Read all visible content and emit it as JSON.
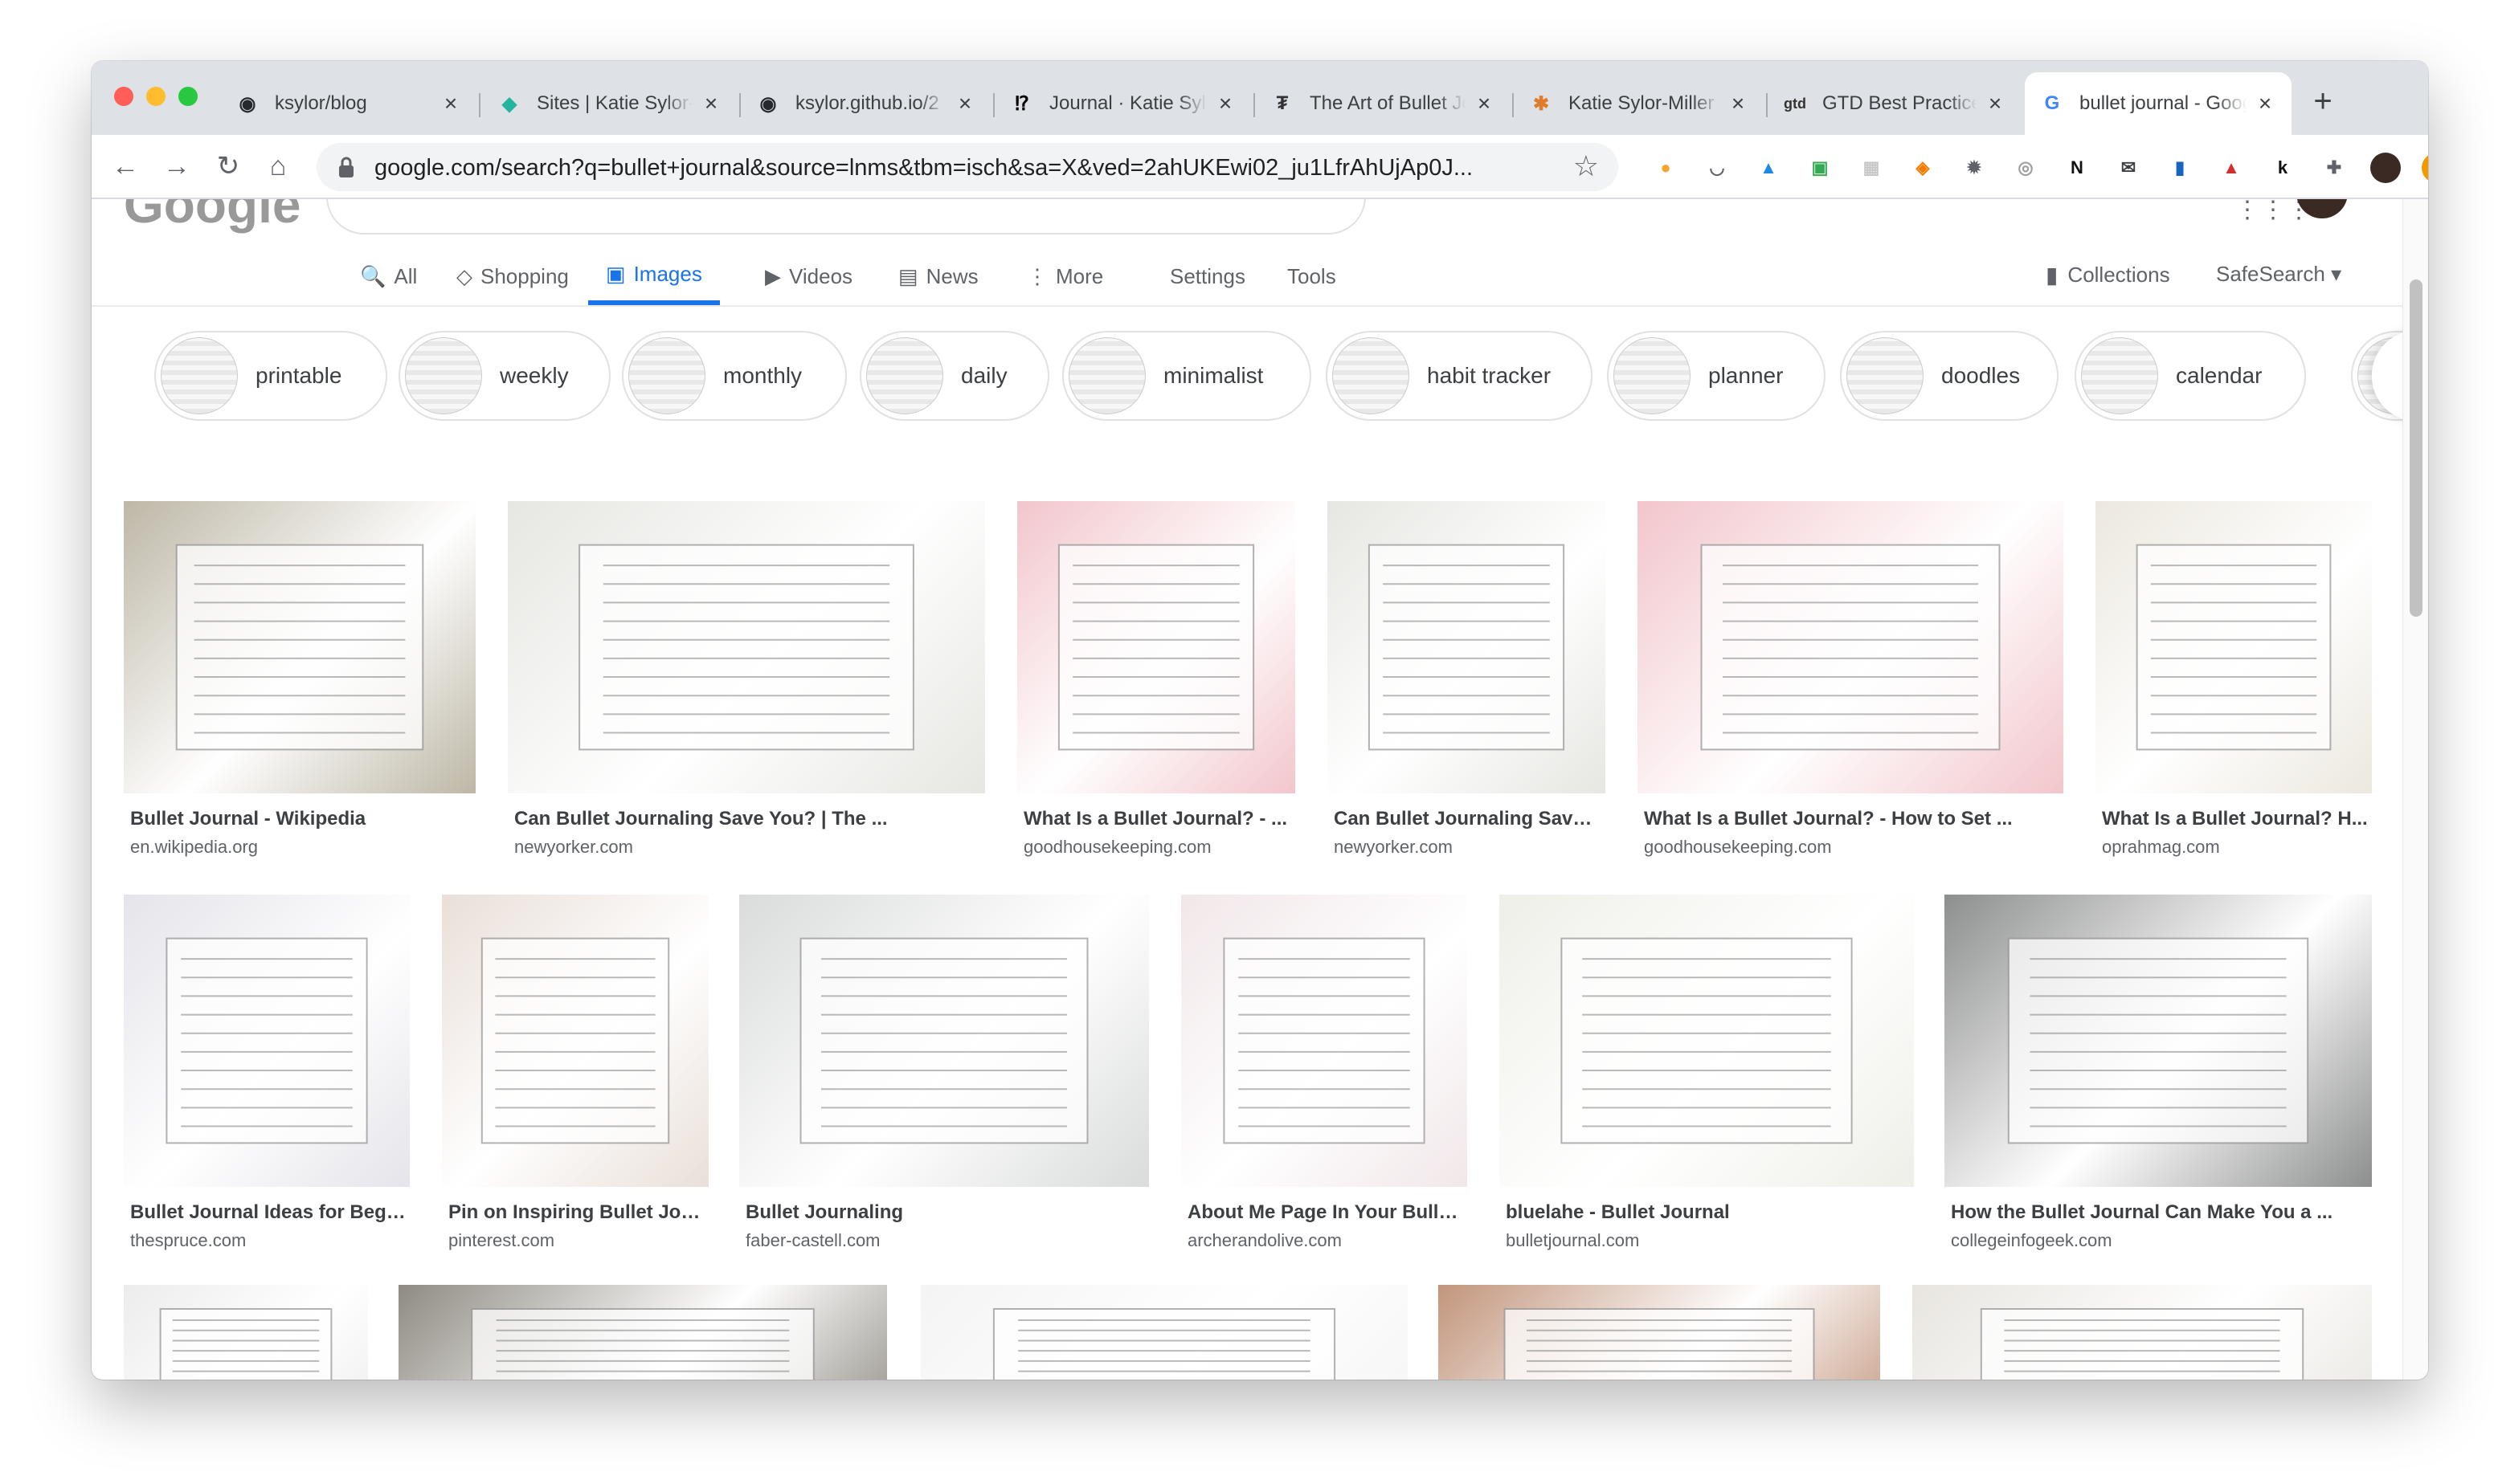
{
  "browser": {
    "tabs": [
      {
        "title": "ksylor/blog",
        "icon": "github-icon",
        "fav": "◉",
        "color": "#24292e"
      },
      {
        "title": "Sites | Katie Sylor-Miller",
        "icon": "netlify-icon",
        "fav": "◆",
        "color": "#25b59f"
      },
      {
        "title": "ksylor.github.io/2",
        "icon": "github-icon",
        "fav": "◉",
        "color": "#24292e"
      },
      {
        "title": "Journal · Katie Sylor-Miller",
        "icon": "journal-icon",
        "fav": "⁉",
        "color": "#000000"
      },
      {
        "title": "The Art of Bullet Journaling",
        "icon": "site-icon",
        "fav": "₮",
        "color": "#333333"
      },
      {
        "title": "Katie Sylor-Miller",
        "icon": "asterisk-icon",
        "fav": "✱",
        "color": "#e07b2a"
      },
      {
        "title": "GTD Best Practices",
        "icon": "gtd-icon",
        "fav": "gtd",
        "color": "#333333"
      },
      {
        "title": "bullet journal - Google Search",
        "icon": "google-icon",
        "fav": "G",
        "color": "#4285f4",
        "active": true
      }
    ],
    "new_tab": "+",
    "url": "google.com/search?q=bullet+journal&source=lnms&tbm=isch&sa=X&ved=2ahUKEwi02_ju1LfrAhUjAp0J...",
    "extensions": [
      {
        "name": "extension-chrome-icon",
        "glyph": "●",
        "color": "#f4a430"
      },
      {
        "name": "extension-pocket-icon",
        "glyph": "◡",
        "color": "#5f6368"
      },
      {
        "name": "extension-drive-icon",
        "glyph": "▲",
        "color": "#1e88e5"
      },
      {
        "name": "extension-green-icon",
        "glyph": "▣",
        "color": "#34a853"
      },
      {
        "name": "extension-gray-icon",
        "glyph": "▦",
        "color": "#c8c8c8"
      },
      {
        "name": "extension-orange-icon",
        "glyph": "◈",
        "color": "#f57c00"
      },
      {
        "name": "extension-gear-icon",
        "glyph": "✹",
        "color": "#5f6368"
      },
      {
        "name": "extension-circle-icon",
        "glyph": "◎",
        "color": "#9e9e9e"
      },
      {
        "name": "extension-notion-icon",
        "glyph": "N",
        "color": "#111111"
      },
      {
        "name": "extension-mail-icon",
        "glyph": "✉",
        "color": "#3c4043"
      },
      {
        "name": "extension-bars-icon",
        "glyph": "▮",
        "color": "#1565c0"
      },
      {
        "name": "extension-lastpass-icon",
        "glyph": "▲",
        "color": "#d32f2f"
      },
      {
        "name": "extension-k-icon",
        "glyph": "k",
        "color": "#111111"
      },
      {
        "name": "extension-puzzle-icon",
        "glyph": "✚",
        "color": "#5f6368"
      },
      {
        "name": "profile-avatar-icon",
        "glyph": "●",
        "color": "#3b2a24"
      },
      {
        "name": "update-icon",
        "glyph": "↑",
        "color": "#f29900"
      }
    ]
  },
  "google": {
    "nav": [
      {
        "label": "All",
        "icon": "🔍"
      },
      {
        "label": "Shopping",
        "icon": "◇"
      },
      {
        "label": "Images",
        "icon": "▣",
        "active": true
      },
      {
        "label": "Videos",
        "icon": "▶"
      },
      {
        "label": "News",
        "icon": "▤"
      },
      {
        "label": "More",
        "icon": "⋮"
      }
    ],
    "settings": "Settings",
    "tools": "Tools",
    "collections": "Collections",
    "safesearch": "SafeSearch ▾",
    "chips": [
      "printable",
      "weekly",
      "monthly",
      "daily",
      "minimalist",
      "habit tracker",
      "planner",
      "doodles",
      "calendar"
    ],
    "results_row1": [
      {
        "title": "Bullet Journal - Wikipedia",
        "source": "en.wikipedia.org",
        "bg": "#bdb7a6"
      },
      {
        "title": "Can Bullet Journaling Save You? | The ...",
        "source": "newyorker.com",
        "bg": "#e6e6e2"
      },
      {
        "title": "What Is a Bullet Journal? - ...",
        "source": "goodhousekeeping.com",
        "bg": "#f2c6cc"
      },
      {
        "title": "Can Bullet Journaling Save ...",
        "source": "newyorker.com",
        "bg": "#e6e6e2"
      },
      {
        "title": "What Is a Bullet Journal? - How to Set ...",
        "source": "goodhousekeeping.com",
        "bg": "#f2c6cc"
      },
      {
        "title": "What Is a Bullet Journal? H...",
        "source": "oprahmag.com",
        "bg": "#ece8df"
      }
    ],
    "results_row2": [
      {
        "title": "Bullet Journal Ideas for Begi...",
        "source": "thespruce.com",
        "bg": "#e4e4ea"
      },
      {
        "title": "Pin on Inspiring Bullet Jou...",
        "source": "pinterest.com",
        "bg": "#e9dfd8"
      },
      {
        "title": "Bullet Journaling",
        "source": "faber-castell.com",
        "bg": "#d9dcda"
      },
      {
        "title": "About Me Page In Your Bulle...",
        "source": "archerandolive.com",
        "bg": "#f1e7e9"
      },
      {
        "title": "bluelahe - Bullet Journal",
        "source": "bulletjournal.com",
        "bg": "#efefe9"
      },
      {
        "title": "How the Bullet Journal Can Make You a ...",
        "source": "collegeinfogeek.com",
        "bg": "#8d8f8e"
      }
    ],
    "results_row3": [
      {
        "bg": "#ececec"
      },
      {
        "bg": "#8f8b83"
      },
      {
        "bg": "#f4f4f4"
      },
      {
        "bg": "#c2957c"
      },
      {
        "bg": "#e8e5e0"
      }
    ]
  }
}
